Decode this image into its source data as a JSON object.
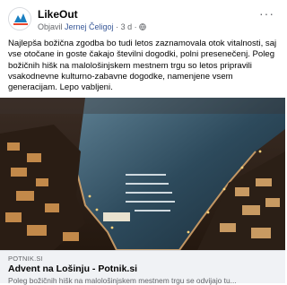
{
  "post": {
    "page_name": "LikeOut",
    "meta_prefix": "Objavil",
    "author": "Jernej Čeligoj",
    "separator": "·",
    "time": "3 d",
    "more_label": "···",
    "text": "Najlepša božična zgodba bo tudi letos zaznamovala otok vitalnosti, saj vse otočane in goste čakajo številni dogodki, polni presenečenj. Poleg božičnih hišk na malološinjskem mestnem trgu so letos pripravili vsakodnevne kulturno-zabavne dogodke, namenjene vsem generacijam. Lepo vabljeni.",
    "link": {
      "domain": "POTNIK.SI",
      "title": "Advent na Lošinju - Potnik.si",
      "description": "Poleg božičnih hišk na malološinjskem mestnem trgu se odvijajo tu..."
    }
  }
}
